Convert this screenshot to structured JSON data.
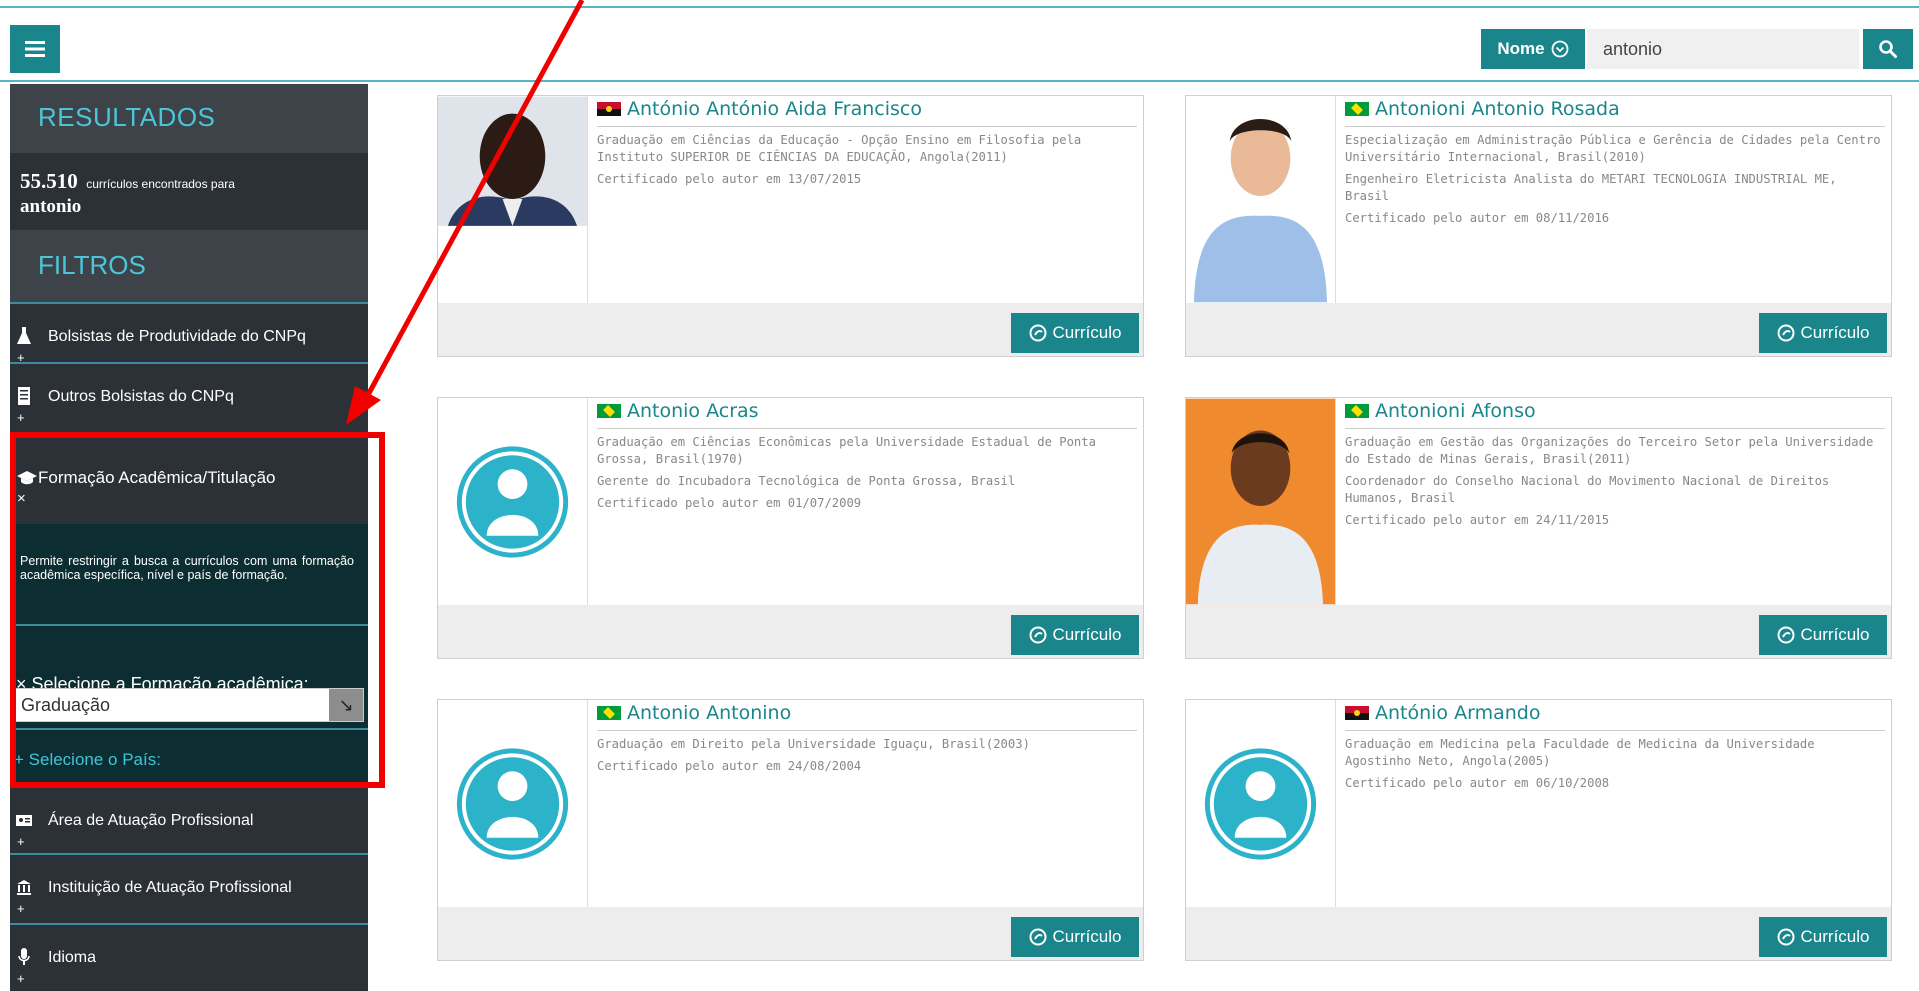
{
  "search": {
    "mode_label": "Nome",
    "value": "antonio"
  },
  "sidebar": {
    "results_title": "RESULTADOS",
    "count_value": "55.510",
    "count_text": "currículos encontrados para",
    "count_term": "antonio",
    "filters_title": "FILTROS",
    "filters": [
      {
        "label": "Bolsistas de Produtividade do CNPq",
        "icon": "flask-icon",
        "state": "+"
      },
      {
        "label": "Outros Bolsistas do CNPq",
        "icon": "document-icon",
        "state": "+"
      },
      {
        "label": "Formação Acadêmica/Titulação",
        "icon": "graduation-cap-icon",
        "state": "×"
      },
      {
        "label": "Área de Atuação Profissional",
        "icon": "id-card-icon",
        "state": "+"
      },
      {
        "label": "Instituição de Atuação Profissional",
        "icon": "institution-icon",
        "state": "+"
      },
      {
        "label": "Idioma",
        "icon": "microphone-icon",
        "state": "+"
      }
    ],
    "active_filter": {
      "description": "Permite restringir a busca a currículos com uma formação acadêmica específica, nível e país de formação.",
      "select_label": "× Selecione a Formação acadêmica:",
      "selected_value": "Graduação",
      "country_label": "+ Selecione o País:"
    }
  },
  "results": [
    {
      "name": "António António Aida Francisco",
      "flag": "ao",
      "photo": "person-photo",
      "lines": [
        "Graduação em Ciências da Educação - Opção Ensino em Filosofia pela Instituto SUPERIOR DE CIÊNCIAS DA EDUCAÇÃO, Angola(2011)",
        "Certificado pelo autor em 13/07/2015"
      ],
      "button": "Currículo"
    },
    {
      "name": "Antonioni Antonio Rosada",
      "flag": "br",
      "photo": "person-photo",
      "lines": [
        "Especialização em Administração Pública e Gerência de Cidades pela Centro Universitário Internacional, Brasil(2010)",
        "Engenheiro Eletricista Analista do METARI TECNOLOGIA INDUSTRIAL ME, Brasil",
        "Certificado pelo autor em 08/11/2016"
      ],
      "button": "Currículo"
    },
    {
      "name": "Antonio Acras",
      "flag": "br",
      "photo": "avatar-placeholder",
      "lines": [
        "Graduação em Ciências Econômicas pela Universidade Estadual de Ponta Grossa, Brasil(1970)",
        "Gerente do Incubadora Tecnológica de Ponta Grossa, Brasil",
        "Certificado pelo autor em 01/07/2009"
      ],
      "button": "Currículo"
    },
    {
      "name": "Antonioni Afonso",
      "flag": "br",
      "photo": "person-photo",
      "lines": [
        "Graduação em Gestão das Organizações do Terceiro Setor pela Universidade do Estado de Minas Gerais, Brasil(2011)",
        "Coordenador do Conselho Nacional do Movimento Nacional de Direitos Humanos, Brasil",
        "Certificado pelo autor em 24/11/2015"
      ],
      "button": "Currículo"
    },
    {
      "name": "Antonio Antonino",
      "flag": "br",
      "photo": "avatar-placeholder",
      "lines": [
        "Graduação em Direito pela Universidade Iguaçu, Brasil(2003)",
        "Certificado pelo autor em 24/08/2004"
      ],
      "button": "Currículo"
    },
    {
      "name": "António Armando",
      "flag": "ao",
      "photo": "avatar-placeholder",
      "lines": [
        "Graduação em Medicina pela Faculdade de Medicina da Universidade Agostinho Neto, Angola(2005)",
        "Certificado pelo autor em 06/10/2008"
      ],
      "button": "Currículo"
    }
  ],
  "colors": {
    "accent": "#1a868b",
    "sidebar": "#2c3137",
    "highlight": "#f10000",
    "heading": "#4bc6d7"
  }
}
